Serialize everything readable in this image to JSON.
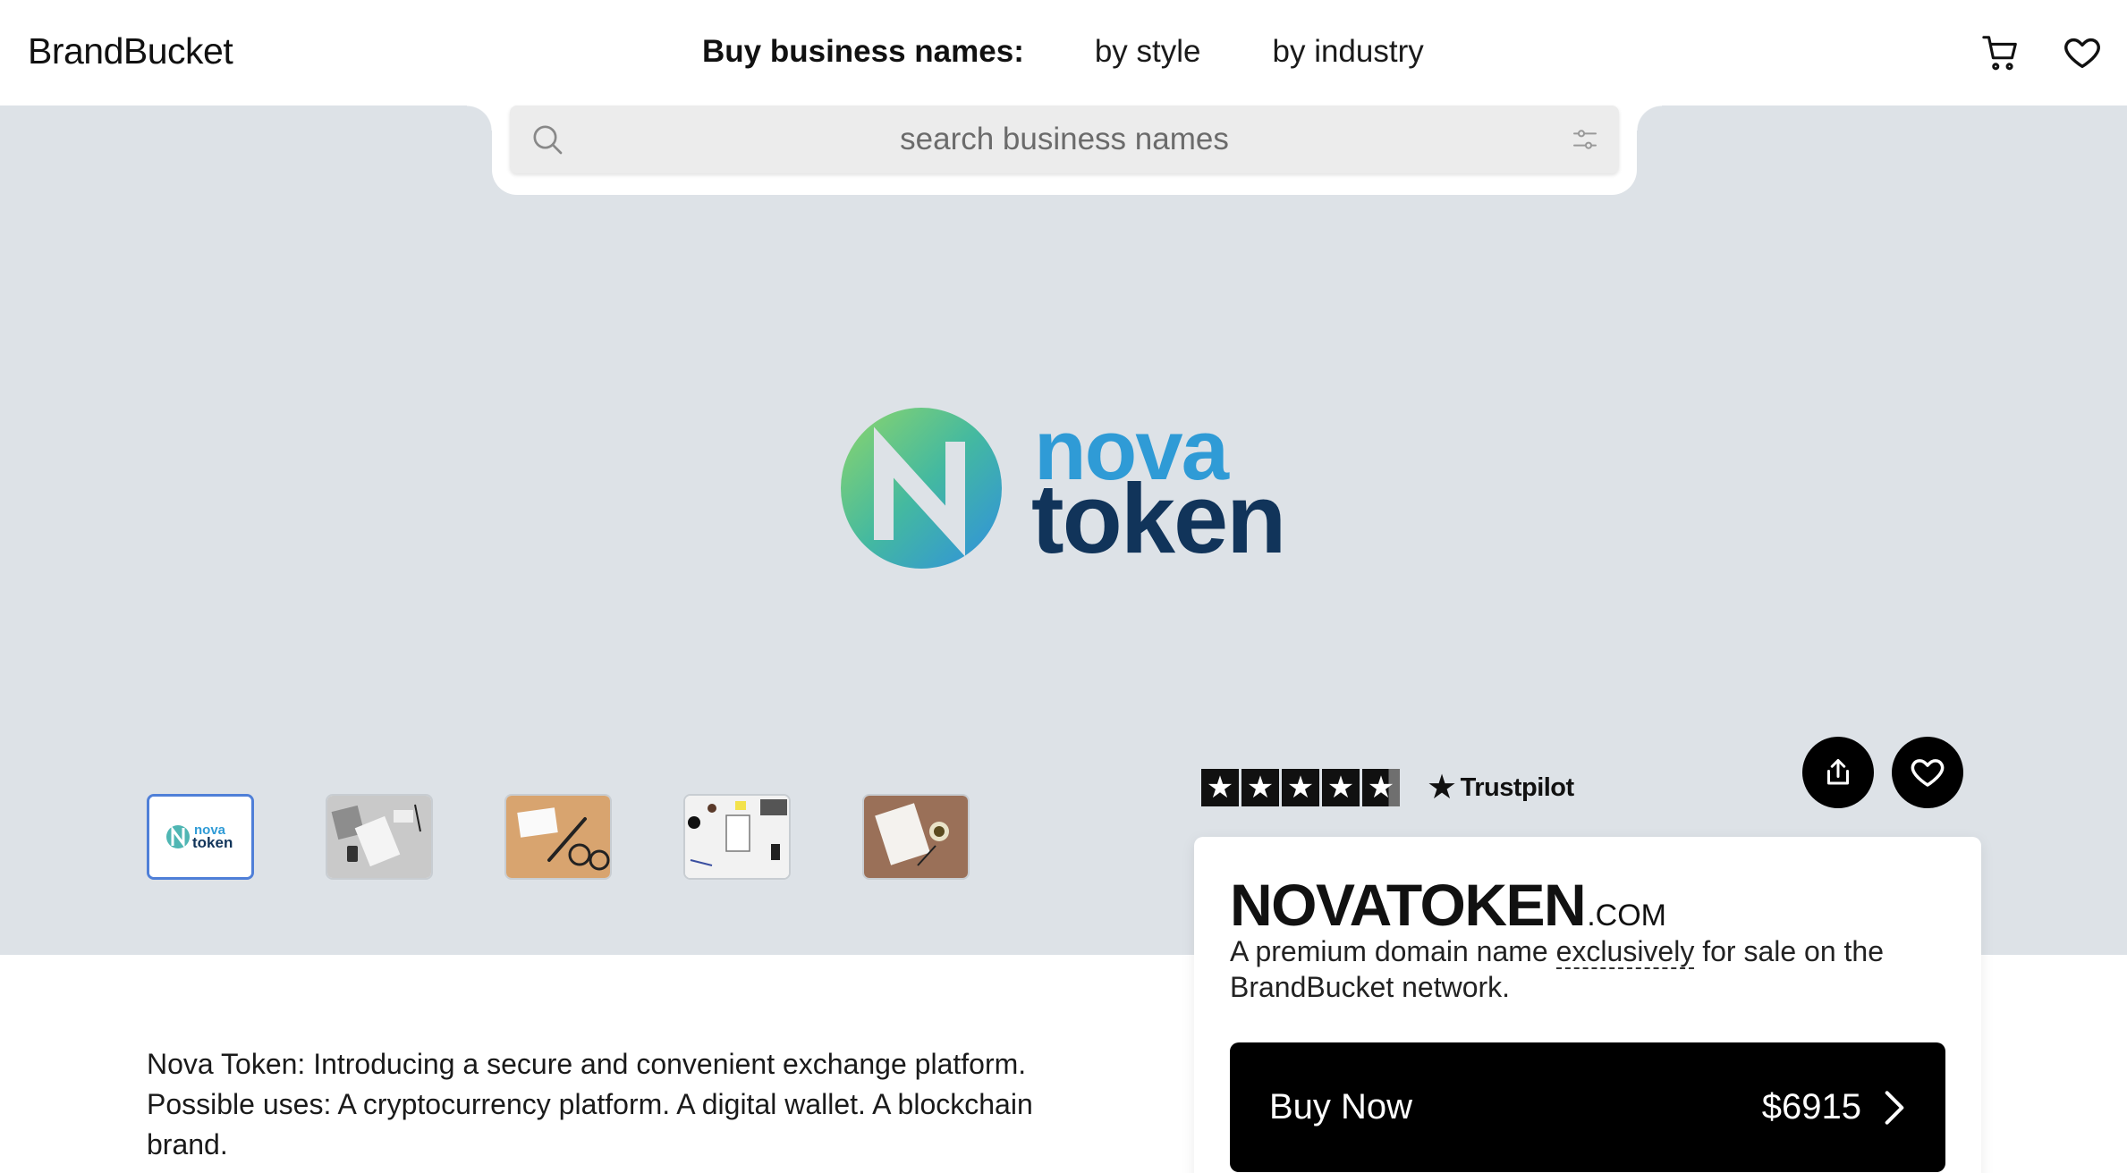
{
  "header": {
    "logo": "BrandBucket",
    "nav_lead": "Buy business names:",
    "nav_links": [
      "by style",
      "by industry"
    ],
    "icons": [
      "cart-icon",
      "heart-icon"
    ]
  },
  "search": {
    "placeholder": "search business names",
    "icons": [
      "search-icon",
      "filter-icon"
    ]
  },
  "hero": {
    "logo_word1": "nova",
    "logo_word2": "token",
    "thumbnails": [
      "logo",
      "desk-white",
      "desk-wood-glasses",
      "desk-stationery",
      "desk-coffee"
    ],
    "active_thumbnail": 0
  },
  "rating": {
    "stars": 4.5,
    "brand": "Trustpilot"
  },
  "card": {
    "domain_name": "NOVATOKEN",
    "tld": ".COM",
    "desc_before": "A premium domain name ",
    "desc_emph": "exclusively",
    "desc_after": " for sale on the BrandBucket network.",
    "buy_label": "Buy Now",
    "price": "$6915"
  },
  "about": {
    "text": "Nova Token: Introducing a secure and convenient exchange platform. Possible uses: A cryptocurrency platform. A digital wallet. A blockchain brand."
  },
  "colors": {
    "hero_bg": "#dde2e7",
    "accent_blue": "#2f9bd6",
    "navy": "#11345a",
    "button_bg": "#000000"
  }
}
